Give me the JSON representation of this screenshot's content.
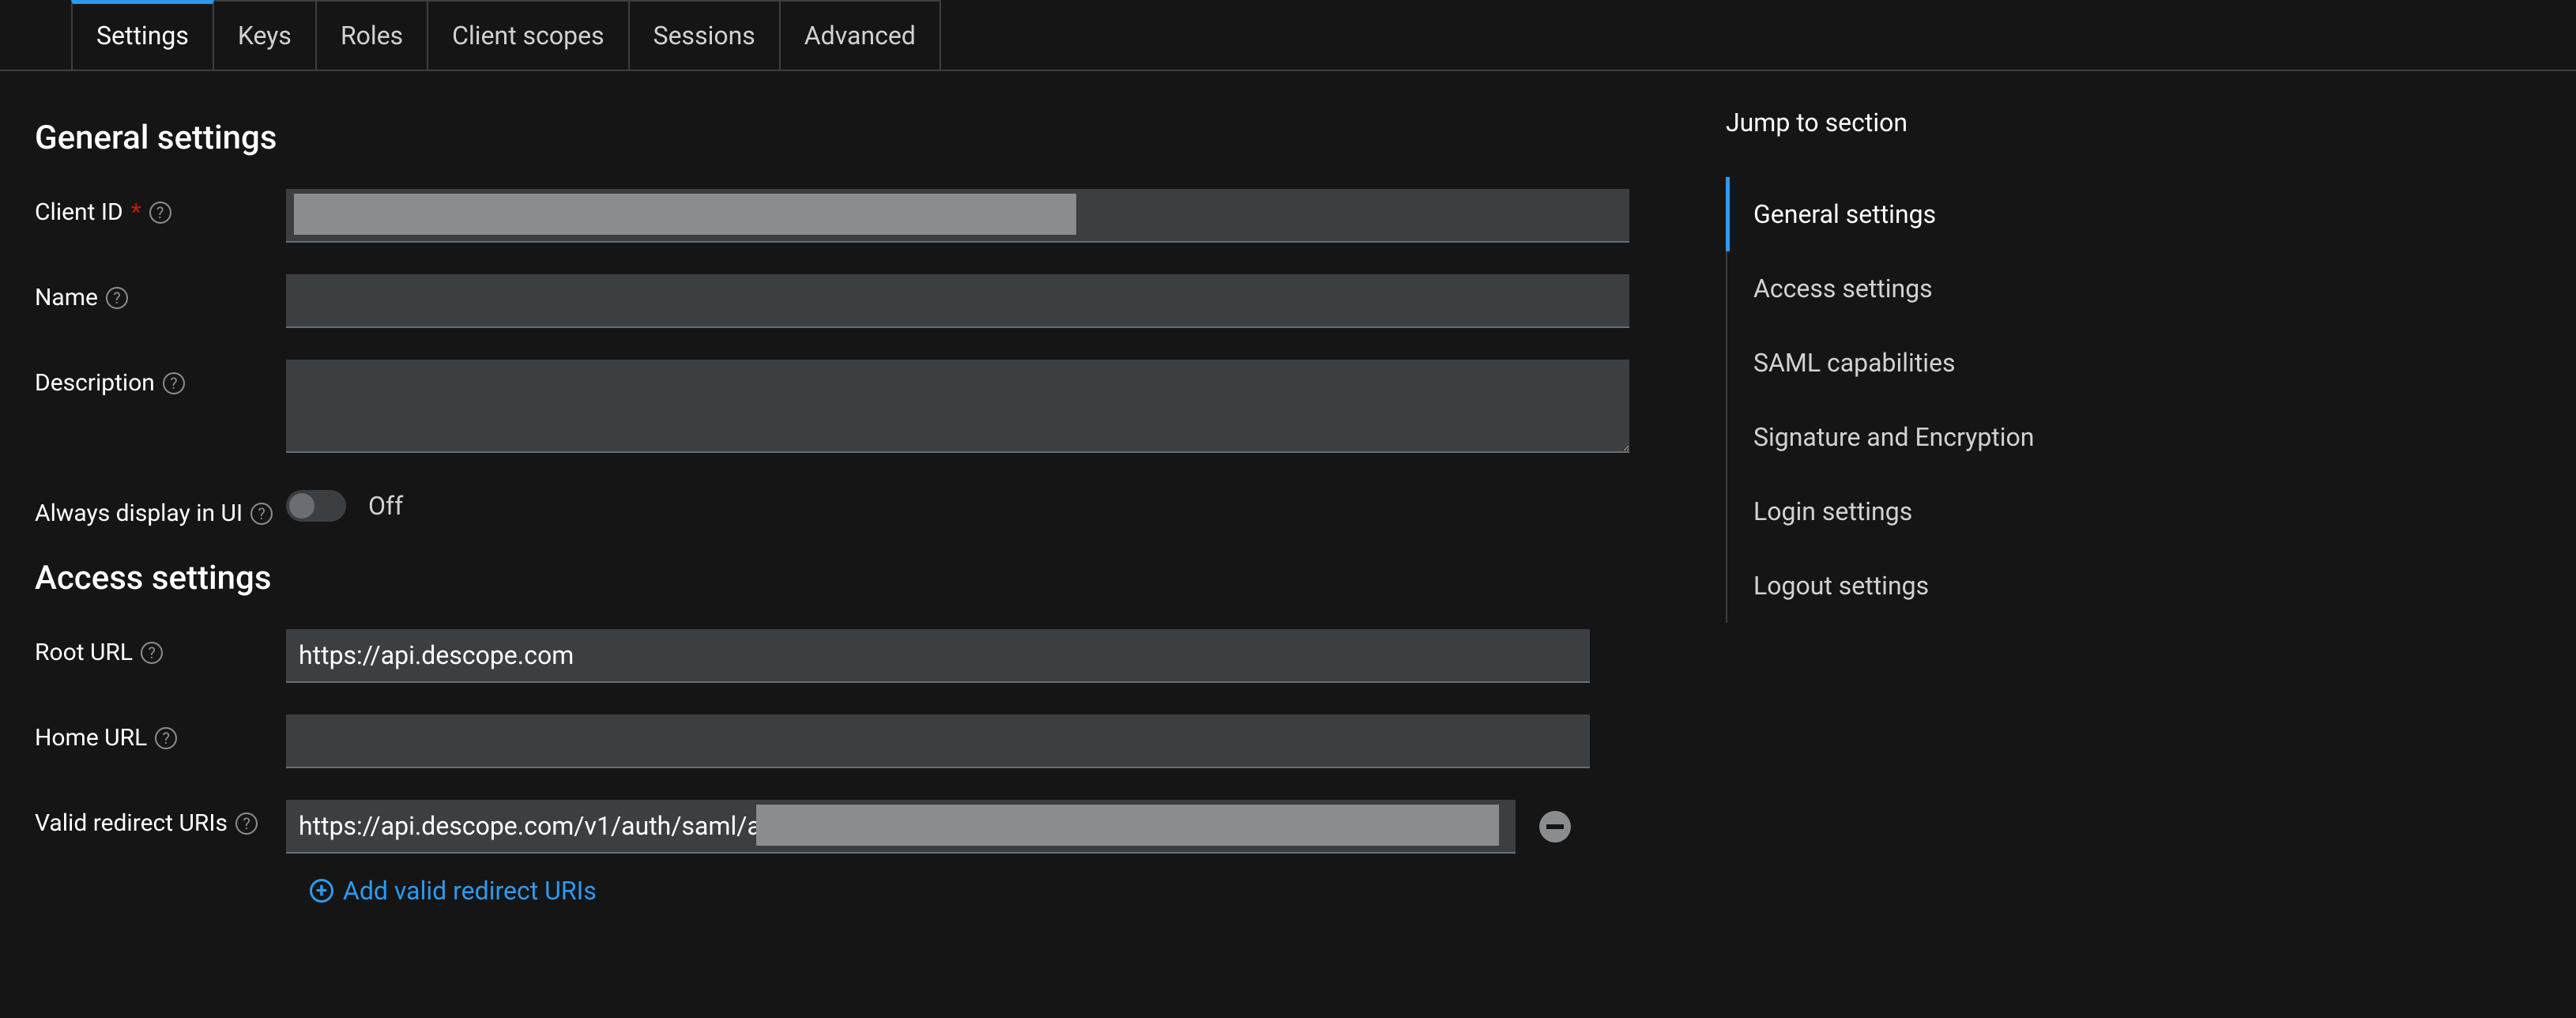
{
  "tabs": [
    {
      "label": "Settings",
      "active": true
    },
    {
      "label": "Keys",
      "active": false
    },
    {
      "label": "Roles",
      "active": false
    },
    {
      "label": "Client scopes",
      "active": false
    },
    {
      "label": "Sessions",
      "active": false
    },
    {
      "label": "Advanced",
      "active": false
    }
  ],
  "sections": {
    "general": {
      "title": "General settings",
      "fields": {
        "client_id": {
          "label": "Client ID",
          "value": "",
          "required": true
        },
        "name": {
          "label": "Name",
          "value": ""
        },
        "description": {
          "label": "Description",
          "value": ""
        },
        "always_display": {
          "label": "Always display in UI",
          "value": false,
          "value_label": "Off"
        }
      }
    },
    "access": {
      "title": "Access settings",
      "fields": {
        "root_url": {
          "label": "Root URL",
          "value": "https://api.descope.com"
        },
        "home_url": {
          "label": "Home URL",
          "value": ""
        },
        "valid_redirect_uris": {
          "label": "Valid redirect URIs",
          "values": [
            "https://api.descope.com/v1/auth/saml/acs?"
          ],
          "add_label": "Add valid redirect URIs"
        }
      }
    }
  },
  "jump": {
    "title": "Jump to section",
    "items": [
      {
        "label": "General settings",
        "active": true
      },
      {
        "label": "Access settings",
        "active": false
      },
      {
        "label": "SAML capabilities",
        "active": false
      },
      {
        "label": "Signature and Encryption",
        "active": false
      },
      {
        "label": "Login settings",
        "active": false
      },
      {
        "label": "Logout settings",
        "active": false
      }
    ]
  }
}
